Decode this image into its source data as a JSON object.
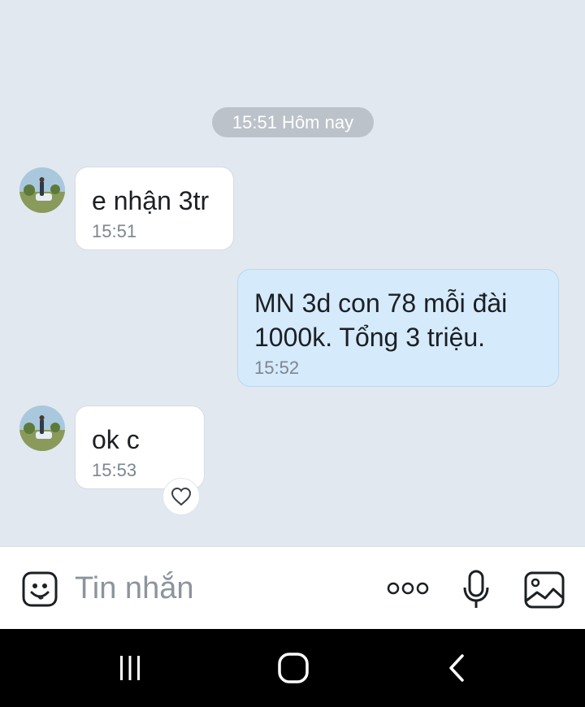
{
  "chat": {
    "date_separator": "15:51 Hôm nay",
    "messages": [
      {
        "direction": "incoming",
        "text": "e nhận 3tr",
        "time": "15:51"
      },
      {
        "direction": "outgoing",
        "text": "MN 3d con 78 mỗi đài\n1000k. Tổng 3 triệu.",
        "time": "15:52"
      },
      {
        "direction": "incoming",
        "text": "ok c",
        "time": "15:53"
      }
    ]
  },
  "composer": {
    "placeholder": "Tin nhắn",
    "icons": [
      "sticker-icon",
      "more-options-icon",
      "microphone-icon",
      "image-icon"
    ]
  },
  "navbar": {
    "icons": [
      "recent-apps-icon",
      "home-icon",
      "back-icon"
    ]
  },
  "colors": {
    "chat_background": "#e2e8f0",
    "incoming_bubble": "#ffffff",
    "outgoing_bubble": "#d5eafb",
    "timestamp": "#7d8690",
    "date_pill": "#bcc2c9"
  }
}
